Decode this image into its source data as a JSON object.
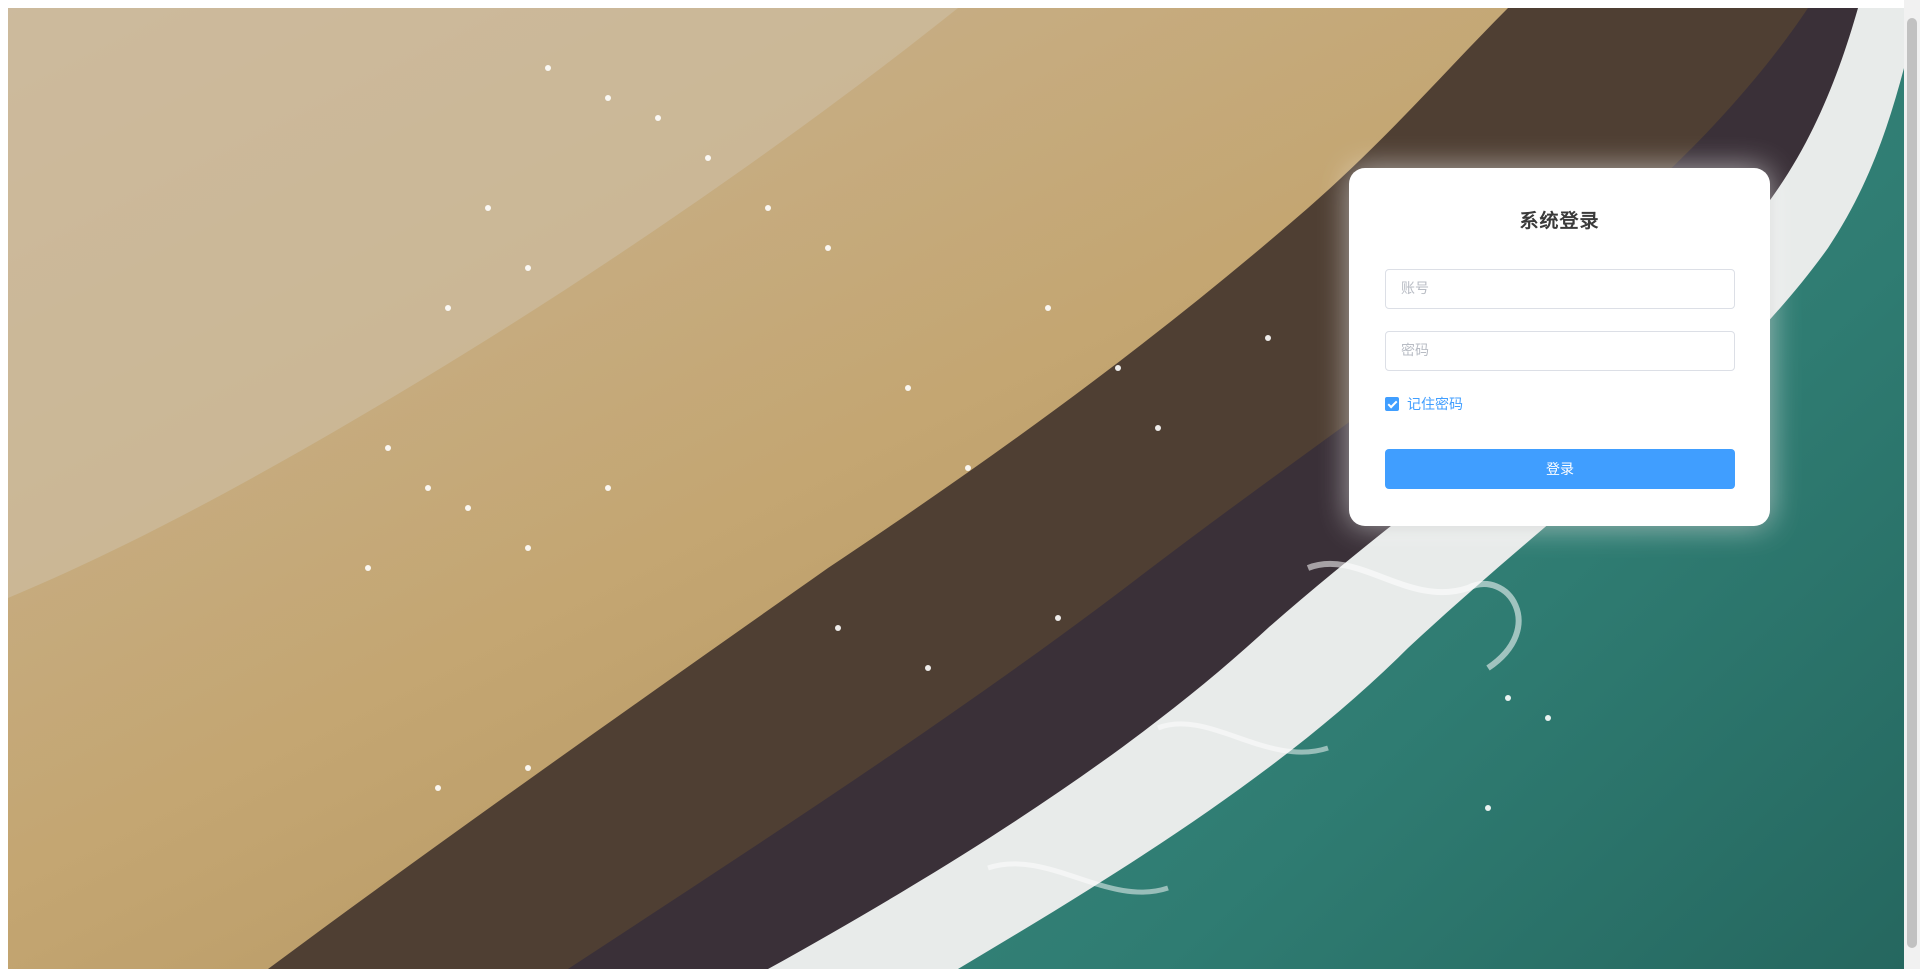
{
  "login": {
    "title": "系统登录",
    "account_placeholder": "账号",
    "password_placeholder": "密码",
    "remember_label": "记住密码",
    "remember_checked": true,
    "submit_label": "登录"
  },
  "theme": {
    "accent": "#409eff"
  }
}
